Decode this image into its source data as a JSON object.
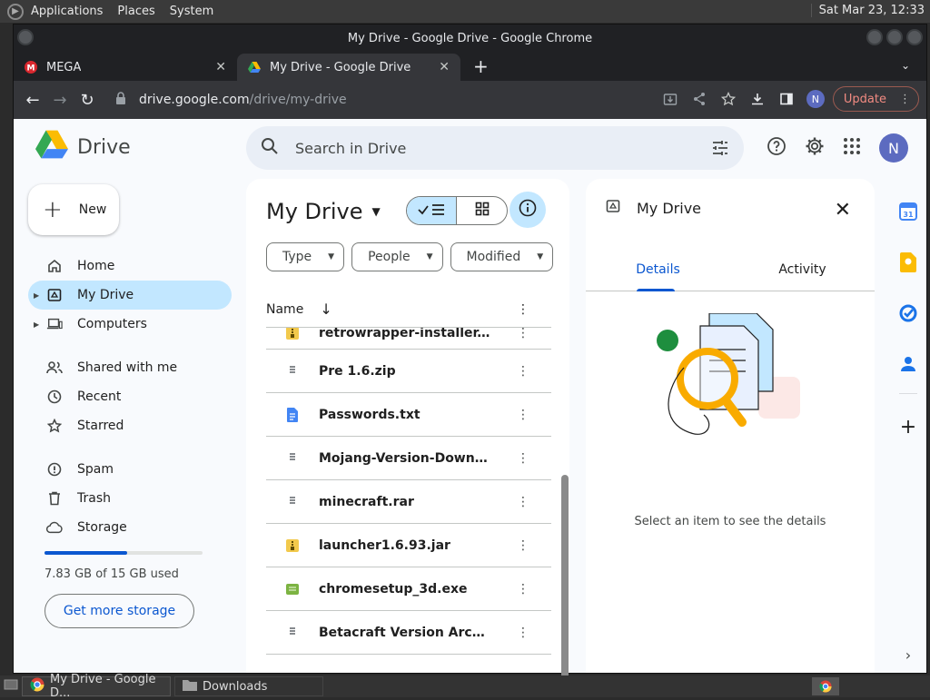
{
  "os": {
    "menu": [
      "Applications",
      "Places",
      "System"
    ],
    "clock": "Sat Mar 23, 12:33"
  },
  "browser": {
    "window_title": "My Drive - Google Drive - Google Chrome",
    "tabs": [
      {
        "label": "MEGA",
        "icon": "mega-icon",
        "active": false
      },
      {
        "label": "My Drive - Google Drive",
        "icon": "drive-icon",
        "active": true
      }
    ],
    "url_host": "drive.google.com",
    "url_path": "/drive/my-drive",
    "profile_initial": "N",
    "update_label": "Update"
  },
  "drive": {
    "brand": "Drive",
    "search_placeholder": "Search in Drive",
    "account_initial": "N",
    "new_label": "New",
    "nav": [
      {
        "label": "Home",
        "icon": "home-icon",
        "selected": false,
        "expandable": false
      },
      {
        "label": "My Drive",
        "icon": "my-drive-icon",
        "selected": true,
        "expandable": true
      },
      {
        "label": "Computers",
        "icon": "computer-icon",
        "selected": false,
        "expandable": true
      },
      {
        "label": "Shared with me",
        "icon": "shared-icon",
        "selected": false,
        "expandable": false
      },
      {
        "label": "Recent",
        "icon": "clock-icon",
        "selected": false,
        "expandable": false
      },
      {
        "label": "Starred",
        "icon": "star-icon",
        "selected": false,
        "expandable": false
      },
      {
        "label": "Spam",
        "icon": "spam-icon",
        "selected": false,
        "expandable": false
      },
      {
        "label": "Trash",
        "icon": "trash-icon",
        "selected": false,
        "expandable": false
      },
      {
        "label": "Storage",
        "icon": "cloud-icon",
        "selected": false,
        "expandable": false
      }
    ],
    "storage": {
      "used_fraction": 0.522,
      "text": "7.83 GB of 15 GB used",
      "button": "Get more storage"
    },
    "main": {
      "title": "My Drive",
      "filters": [
        "Type",
        "People",
        "Modified"
      ],
      "column_name": "Name",
      "files": [
        {
          "name": "retrowrapper-installer.jar",
          "icon": "archive-icon",
          "color": "#f2c94c"
        },
        {
          "name": "Pre 1.6.zip",
          "icon": "zip-icon",
          "color": "#5f6368"
        },
        {
          "name": "Passwords.txt",
          "icon": "doc-icon",
          "color": "#4285f4"
        },
        {
          "name": "Mojang-Version-Download...",
          "icon": "zip-icon",
          "color": "#5f6368"
        },
        {
          "name": "minecraft.rar",
          "icon": "zip-icon",
          "color": "#5f6368"
        },
        {
          "name": "launcher1.6.93.jar",
          "icon": "archive-icon",
          "color": "#f2c94c"
        },
        {
          "name": "chromesetup_3d.exe",
          "icon": "exe-icon",
          "color": "#7cb342"
        },
        {
          "name": "Betacraft Version Archive....",
          "icon": "zip-icon",
          "color": "#5f6368"
        }
      ]
    },
    "details": {
      "title": "My Drive",
      "tabs": [
        "Details",
        "Activity"
      ],
      "message": "Select an item to see the details"
    }
  },
  "taskbar": {
    "items": [
      "My Drive - Google D...",
      "Downloads"
    ]
  }
}
